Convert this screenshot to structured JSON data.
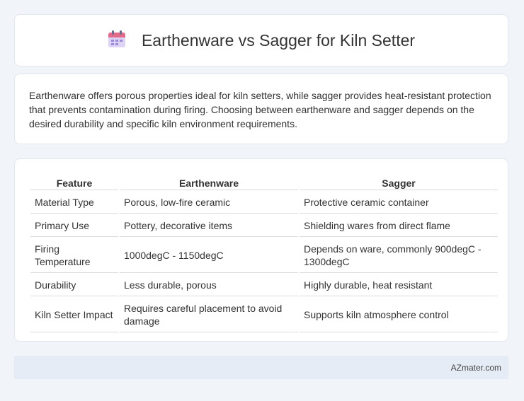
{
  "header": {
    "title": "Earthenware vs Sagger for Kiln Setter",
    "icon": "calendar-icon"
  },
  "description": "Earthenware offers porous properties ideal for kiln setters, while sagger provides heat-resistant protection that prevents contamination during firing. Choosing between earthenware and sagger depends on the desired durability and specific kiln environment requirements.",
  "table": {
    "headers": [
      "Feature",
      "Earthenware",
      "Sagger"
    ],
    "rows": [
      [
        "Material Type",
        "Porous, low-fire ceramic",
        "Protective ceramic container"
      ],
      [
        "Primary Use",
        "Pottery, decorative items",
        "Shielding wares from direct flame"
      ],
      [
        "Firing Temperature",
        "1000degC - 1150degC",
        "Depends on ware, commonly 900degC - 1300degC"
      ],
      [
        "Durability",
        "Less durable, porous",
        "Highly durable, heat resistant"
      ],
      [
        "Kiln Setter Impact",
        "Requires careful placement to avoid damage",
        "Supports kiln atmosphere control"
      ]
    ]
  },
  "footer": {
    "brand": "AZmater.com"
  }
}
